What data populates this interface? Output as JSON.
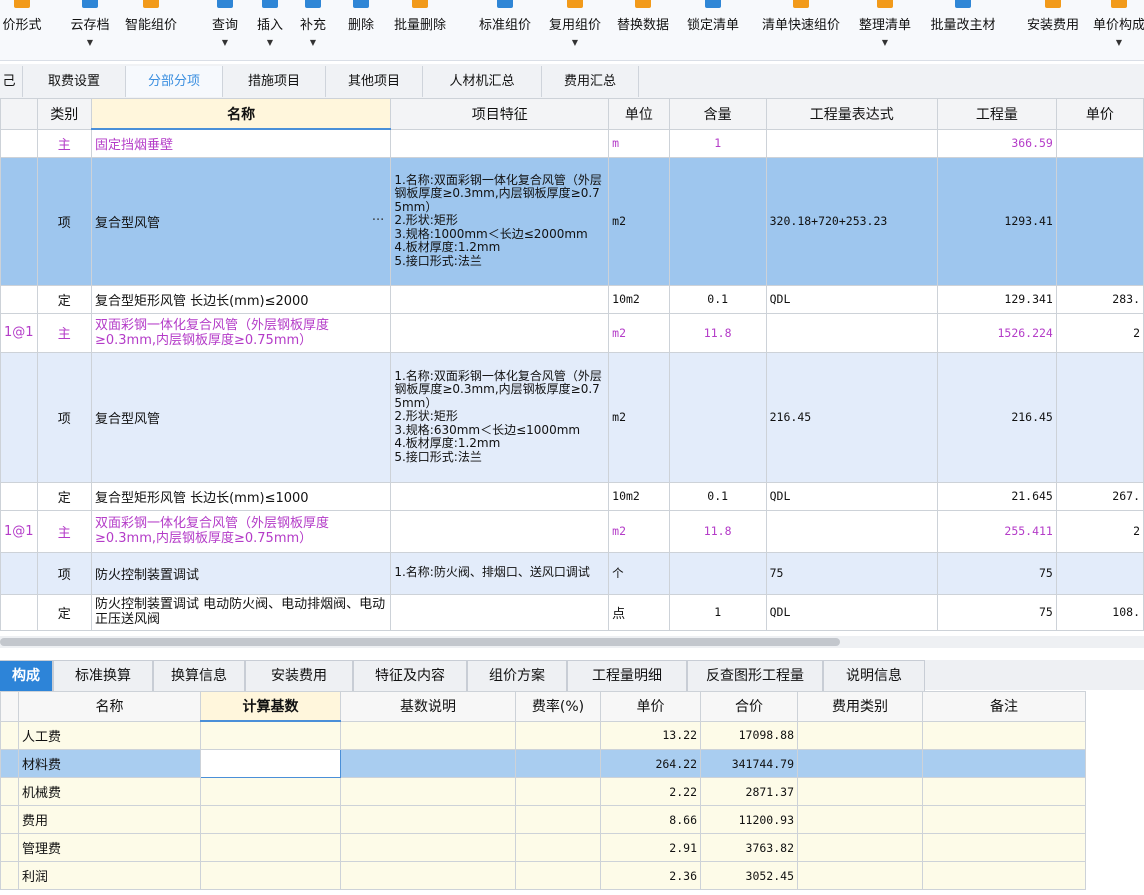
{
  "toolbar": [
    {
      "label": "价形式",
      "dd": false
    },
    {
      "label": "云存档",
      "dd": true
    },
    {
      "label": "智能组价",
      "dd": false
    },
    {
      "label": "查询",
      "dd": true
    },
    {
      "label": "插入",
      "dd": true
    },
    {
      "label": "补充",
      "dd": true
    },
    {
      "label": "删除",
      "dd": false
    },
    {
      "label": "批量删除",
      "dd": false
    },
    {
      "label": "标准组价",
      "dd": false
    },
    {
      "label": "复用组价",
      "dd": true
    },
    {
      "label": "替换数据",
      "dd": false
    },
    {
      "label": "锁定清单",
      "dd": false
    },
    {
      "label": "清单快速组价",
      "dd": false
    },
    {
      "label": "整理清单",
      "dd": true
    },
    {
      "label": "批量改主材",
      "dd": false
    },
    {
      "label": "安装费用",
      "dd": false
    },
    {
      "label": "单价构成",
      "dd": true
    }
  ],
  "tabs": [
    "己",
    "取费设置",
    "分部分项",
    "措施项目",
    "其他项目",
    "人材机汇总",
    "费用汇总"
  ],
  "upper_headers": [
    "",
    "类别",
    "名称",
    "项目特征",
    "单位",
    "含量",
    "工程量表达式",
    "工程量",
    "单价"
  ],
  "upper_rows": [
    {
      "code": "",
      "type": "主",
      "name": "固定挡烟垂壁",
      "feature": "",
      "unit": "m",
      "content": "1",
      "expr": "",
      "qty": "366.59",
      "price": "",
      "style": "main"
    },
    {
      "code": "",
      "type": "项",
      "name": "复合型风管",
      "feature": "1.名称:双面彩钢一体化复合风管（外层钢板厚度≥0.3mm,内层钢板厚度≥0.75mm）\n2.形状:矩形\n3.规格:1000mm＜长边≤2000mm\n4.板材厚度:1.2mm\n5.接口形式:法兰",
      "unit": "m2",
      "content": "",
      "expr": "320.18+720+253.23",
      "qty": "1293.41",
      "price": "",
      "style": "sel",
      "ellipsis": "···"
    },
    {
      "code": "",
      "type": "定",
      "name": "复合型矩形风管 长边长(mm)≤2000",
      "feature": "",
      "unit": "10m2",
      "content": "0.1",
      "expr": "QDL",
      "qty": "129.341",
      "price": "283.",
      "style": "quota"
    },
    {
      "code": "1@1",
      "type": "主",
      "name": "双面彩钢一体化复合风管（外层钢板厚度≥0.3mm,内层钢板厚度≥0.75mm）",
      "feature": "",
      "unit": "m2",
      "content": "11.8",
      "expr": "",
      "qty": "1526.224",
      "price": "2",
      "style": "main"
    },
    {
      "code": "",
      "type": "项",
      "name": "复合型风管",
      "feature": "1.名称:双面彩钢一体化复合风管（外层钢板厚度≥0.3mm,内层钢板厚度≥0.75mm）\n2.形状:矩形\n3.规格:630mm＜长边≤1000mm\n4.板材厚度:1.2mm\n5.接口形式:法兰",
      "unit": "m2",
      "content": "",
      "expr": "216.45",
      "qty": "216.45",
      "price": "",
      "style": "item"
    },
    {
      "code": "",
      "type": "定",
      "name": "复合型矩形风管 长边长(mm)≤1000",
      "feature": "",
      "unit": "10m2",
      "content": "0.1",
      "expr": "QDL",
      "qty": "21.645",
      "price": "267.",
      "style": "quota"
    },
    {
      "code": "1@1",
      "type": "主",
      "name": "双面彩钢一体化复合风管（外层钢板厚度≥0.3mm,内层钢板厚度≥0.75mm）",
      "feature": "",
      "unit": "m2",
      "content": "11.8",
      "expr": "",
      "qty": "255.411",
      "price": "2",
      "style": "main"
    },
    {
      "code": "",
      "type": "项",
      "name": "防火控制装置调试",
      "feature": "1.名称:防火阀、排烟口、送风口调试",
      "unit": "个",
      "content": "",
      "expr": "75",
      "qty": "75",
      "price": "",
      "style": "item"
    },
    {
      "code": "",
      "type": "定",
      "name": "防火控制装置调试 电动防火阀、电动排烟阀、电动正压送风阀",
      "feature": "",
      "unit": "点",
      "content": "1",
      "expr": "QDL",
      "qty": "75",
      "price": "108.",
      "style": "quota"
    }
  ],
  "bottom_tabs": [
    "构成",
    "标准换算",
    "换算信息",
    "安装费用",
    "特征及内容",
    "组价方案",
    "工程量明细",
    "反查图形工程量",
    "说明信息"
  ],
  "lower_headers": [
    "",
    "名称",
    "计算基数",
    "基数说明",
    "费率(%)",
    "单价",
    "合价",
    "费用类别",
    "备注"
  ],
  "lower_rows": [
    {
      "name": "人工费",
      "base": "",
      "desc": "",
      "rate": "",
      "price": "13.22",
      "total": "17098.88",
      "cat": "",
      "note": ""
    },
    {
      "name": "材料费",
      "base": "",
      "desc": "",
      "rate": "",
      "price": "264.22",
      "total": "341744.79",
      "cat": "",
      "note": "",
      "sel": true
    },
    {
      "name": "机械费",
      "base": "",
      "desc": "",
      "rate": "",
      "price": "2.22",
      "total": "2871.37",
      "cat": "",
      "note": ""
    },
    {
      "name": "费用",
      "base": "",
      "desc": "",
      "rate": "",
      "price": "8.66",
      "total": "11200.93",
      "cat": "",
      "note": ""
    },
    {
      "name": "管理费",
      "base": "",
      "desc": "",
      "rate": "",
      "price": "2.91",
      "total": "3763.82",
      "cat": "",
      "note": ""
    },
    {
      "name": "利润",
      "base": "",
      "desc": "",
      "rate": "",
      "price": "2.36",
      "total": "3052.45",
      "cat": "",
      "note": ""
    }
  ],
  "colors": {
    "accent": "#2d84d8",
    "purple": "#b43cc8",
    "selected_row": "#9ec6ee",
    "item_row": "#e3ecfa",
    "lower_row": "#fdfbe8"
  }
}
